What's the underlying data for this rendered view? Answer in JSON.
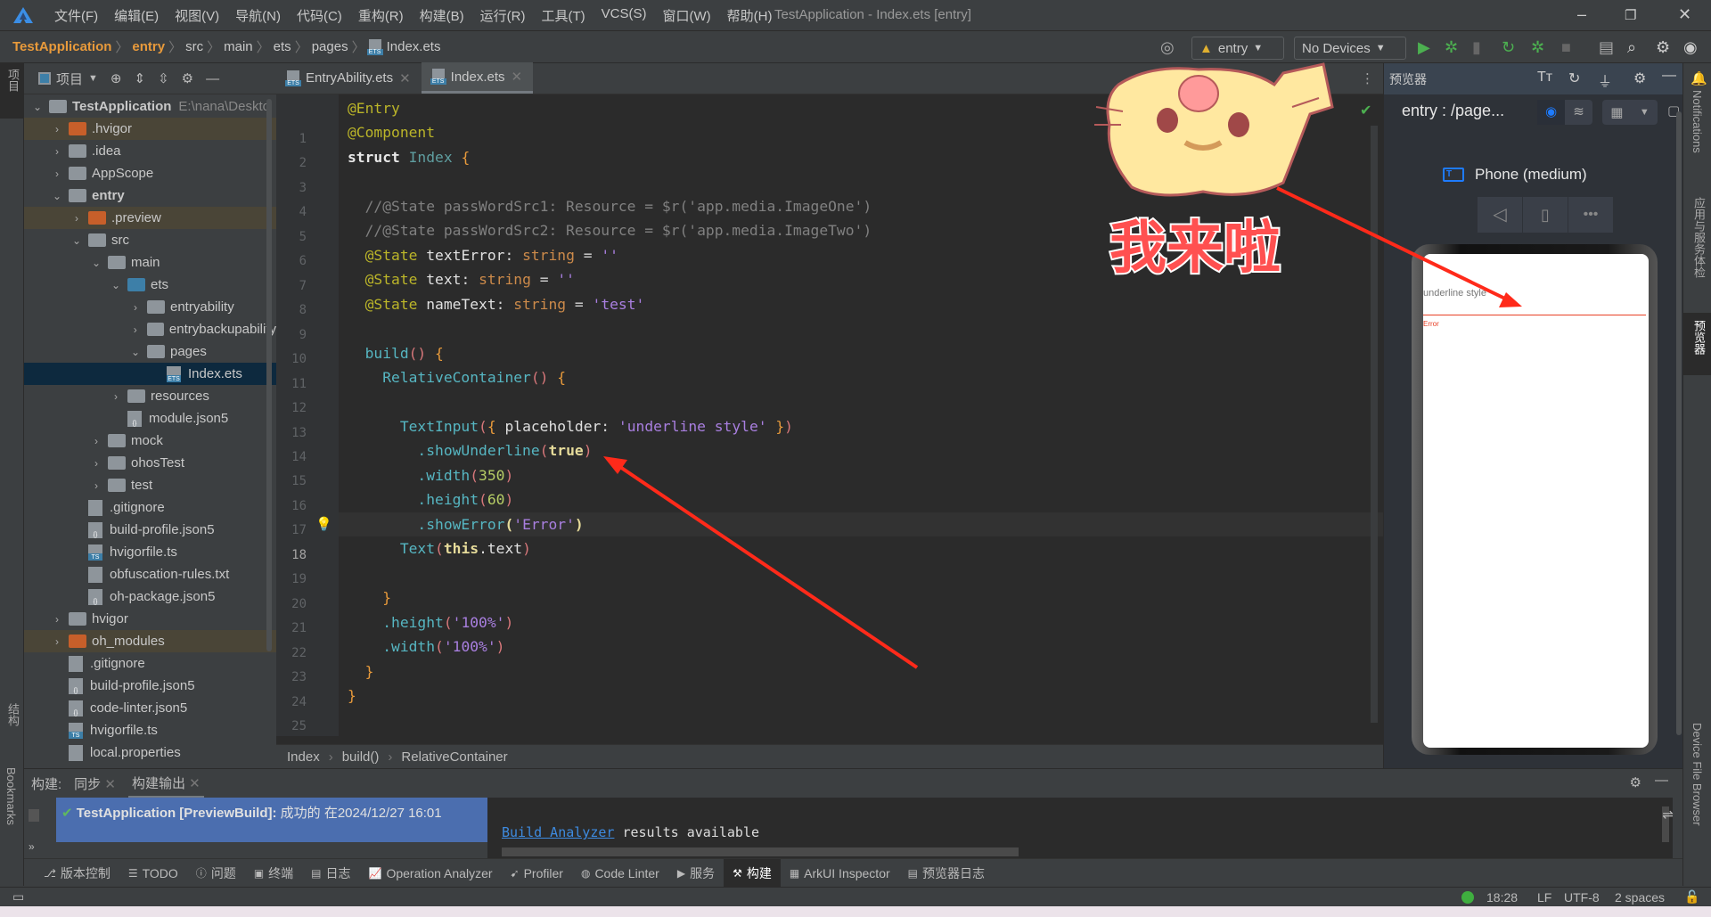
{
  "titlebar": {
    "menu": [
      "文件(F)",
      "编辑(E)",
      "视图(V)",
      "导航(N)",
      "代码(C)",
      "重构(R)",
      "构建(B)",
      "运行(R)",
      "工具(T)",
      "VCS(S)",
      "窗口(W)",
      "帮助(H)"
    ],
    "title": "TestApplication - Index.ets [entry]"
  },
  "navbar": {
    "crumbs": [
      "TestApplication",
      "entry",
      "src",
      "main",
      "ets",
      "pages",
      "Index.ets"
    ],
    "module": "entry",
    "device": "No Devices"
  },
  "left_strip": {
    "project": "项目",
    "structure": "结构",
    "bookmarks": "Bookmarks"
  },
  "project": {
    "label": "项目",
    "root_path": "E:\\nana\\Deskto",
    "tree": [
      {
        "label": "TestApplication",
        "depth": 0,
        "open": true,
        "kind": "module",
        "bold": true
      },
      {
        "label": ".hvigor",
        "depth": 1,
        "kind": "folder-orange",
        "hl": true
      },
      {
        "label": ".idea",
        "depth": 1,
        "kind": "folder"
      },
      {
        "label": "AppScope",
        "depth": 1,
        "kind": "folder"
      },
      {
        "label": "entry",
        "depth": 1,
        "open": true,
        "kind": "module",
        "bold": true
      },
      {
        "label": ".preview",
        "depth": 2,
        "kind": "folder-orange",
        "hl": true
      },
      {
        "label": "src",
        "depth": 2,
        "open": true,
        "kind": "folder"
      },
      {
        "label": "main",
        "depth": 3,
        "open": true,
        "kind": "folder"
      },
      {
        "label": "ets",
        "depth": 4,
        "open": true,
        "kind": "folder-blue"
      },
      {
        "label": "entryability",
        "depth": 5,
        "kind": "folder"
      },
      {
        "label": "entrybackupability",
        "depth": 5,
        "kind": "folder"
      },
      {
        "label": "pages",
        "depth": 5,
        "open": true,
        "kind": "folder"
      },
      {
        "label": "Index.ets",
        "depth": 6,
        "kind": "ets",
        "selected": true
      },
      {
        "label": "resources",
        "depth": 4,
        "kind": "folder"
      },
      {
        "label": "module.json5",
        "depth": 4,
        "kind": "json"
      },
      {
        "label": "mock",
        "depth": 3,
        "kind": "folder"
      },
      {
        "label": "ohosTest",
        "depth": 3,
        "kind": "folder"
      },
      {
        "label": "test",
        "depth": 3,
        "kind": "folder"
      },
      {
        "label": ".gitignore",
        "depth": 2,
        "kind": "file"
      },
      {
        "label": "build-profile.json5",
        "depth": 2,
        "kind": "json"
      },
      {
        "label": "hvigorfile.ts",
        "depth": 2,
        "kind": "ts"
      },
      {
        "label": "obfuscation-rules.txt",
        "depth": 2,
        "kind": "file"
      },
      {
        "label": "oh-package.json5",
        "depth": 2,
        "kind": "json"
      },
      {
        "label": "hvigor",
        "depth": 1,
        "kind": "folder"
      },
      {
        "label": "oh_modules",
        "depth": 1,
        "kind": "folder-orange",
        "hl": true
      },
      {
        "label": ".gitignore",
        "depth": 1,
        "kind": "file"
      },
      {
        "label": "build-profile.json5",
        "depth": 1,
        "kind": "json"
      },
      {
        "label": "code-linter.json5",
        "depth": 1,
        "kind": "json"
      },
      {
        "label": "hvigorfile.ts",
        "depth": 1,
        "kind": "ts"
      },
      {
        "label": "local.properties",
        "depth": 1,
        "kind": "file"
      }
    ]
  },
  "editor": {
    "tabs": [
      {
        "label": "EntryAbility.ets",
        "active": false
      },
      {
        "label": "Index.ets",
        "active": true
      }
    ],
    "current_line": 18,
    "lines": [
      [
        [
          "@Entry",
          "a"
        ]
      ],
      [
        [
          "@Component",
          "a"
        ]
      ],
      [
        [
          "struct ",
          "k"
        ],
        [
          "Index ",
          "cn"
        ],
        [
          "{",
          "b"
        ]
      ],
      [],
      [
        [
          "  //@State passWordSrc1: Resource = $r('app.media.ImageOne')",
          "cm"
        ]
      ],
      [
        [
          "  //@State passWordSrc2: Resource = $r('app.media.ImageTwo')",
          "cm"
        ]
      ],
      [
        [
          "  @State ",
          "a"
        ],
        [
          "textError",
          "v"
        ],
        [
          ": ",
          "o"
        ],
        [
          "string",
          "t"
        ],
        [
          " = ",
          "o"
        ],
        [
          "''",
          "s"
        ]
      ],
      [
        [
          "  @State ",
          "a"
        ],
        [
          "text",
          "v"
        ],
        [
          ": ",
          "o"
        ],
        [
          "string",
          "t"
        ],
        [
          " = ",
          "o"
        ],
        [
          "''",
          "s"
        ]
      ],
      [
        [
          "  @State ",
          "a"
        ],
        [
          "nameText",
          "v"
        ],
        [
          ": ",
          "o"
        ],
        [
          "string",
          "t"
        ],
        [
          " = ",
          "o"
        ],
        [
          "'test'",
          "s"
        ]
      ],
      [],
      [
        [
          "  build",
          "f"
        ],
        [
          "()",
          "p"
        ],
        [
          " {",
          "b"
        ]
      ],
      [
        [
          "    RelativeContainer",
          "f"
        ],
        [
          "()",
          "p"
        ],
        [
          " {",
          "b"
        ]
      ],
      [],
      [
        [
          "      TextInput",
          "f"
        ],
        [
          "(",
          "p"
        ],
        [
          "{ ",
          "b"
        ],
        [
          "placeholder",
          "v"
        ],
        [
          ": ",
          "o"
        ],
        [
          "'underline style'",
          "s"
        ],
        [
          " }",
          "b"
        ],
        [
          ")",
          "p"
        ]
      ],
      [
        [
          "        .showUnderline",
          "f"
        ],
        [
          "(",
          "p"
        ],
        [
          "true",
          "bo"
        ],
        [
          ")",
          "p"
        ]
      ],
      [
        [
          "        .width",
          "f"
        ],
        [
          "(",
          "p"
        ],
        [
          "350",
          "n"
        ],
        [
          ")",
          "p"
        ]
      ],
      [
        [
          "        .height",
          "f"
        ],
        [
          "(",
          "p"
        ],
        [
          "60",
          "n"
        ],
        [
          ")",
          "p"
        ]
      ],
      [
        [
          "        .showError",
          "f"
        ],
        [
          "(",
          "bo"
        ],
        [
          "'Error'",
          "s"
        ],
        [
          ")",
          "bo"
        ]
      ],
      [
        [
          "      Text",
          "f"
        ],
        [
          "(",
          "p"
        ],
        [
          "this",
          "bo"
        ],
        [
          ".text",
          "v"
        ],
        [
          ")",
          "p"
        ]
      ],
      [],
      [
        [
          "    }",
          "b"
        ]
      ],
      [
        [
          "    .height",
          "f"
        ],
        [
          "(",
          "p"
        ],
        [
          "'100%'",
          "s"
        ],
        [
          ")",
          "p"
        ]
      ],
      [
        [
          "    .width",
          "f"
        ],
        [
          "(",
          "p"
        ],
        [
          "'100%'",
          "s"
        ],
        [
          ")",
          "p"
        ]
      ],
      [
        [
          "  }",
          "b"
        ]
      ],
      [
        [
          "}",
          "b"
        ]
      ]
    ],
    "breadcrumb": [
      "Index",
      "build()",
      "RelativeContainer"
    ]
  },
  "preview": {
    "title": "预览器",
    "page": "entry : /page...",
    "device": "Phone (medium)",
    "placeholder": "underline style",
    "error": "Error",
    "error_color": "#e84026"
  },
  "right_strip": {
    "notifications": "Notifications",
    "health": "应用与服务体检",
    "previewer": "预览器",
    "device_file_browser": "Device File Browser"
  },
  "annotation": {
    "sticker_text": "我来啦",
    "arrow_color": "#ff2a1a"
  },
  "build": {
    "label": "构建:",
    "tabs": [
      "同步",
      "构建输出"
    ],
    "result_title": "TestApplication [PreviewBuild]:",
    "result_status": "成功的 在2024/12/27 16:01",
    "analyzer_link": "Build Analyzer",
    "analyzer_text": " results available"
  },
  "tool_tabs": [
    "版本控制",
    "TODO",
    "问题",
    "终端",
    "日志",
    "Operation Analyzer",
    "Profiler",
    "Code Linter",
    "服务",
    "构建",
    "ArkUI Inspector",
    "预览器日志"
  ],
  "tool_tabs_active": "构建",
  "status": {
    "position": "18:28",
    "line_sep": "LF",
    "encoding": "UTF-8",
    "indent": "2 spaces"
  }
}
